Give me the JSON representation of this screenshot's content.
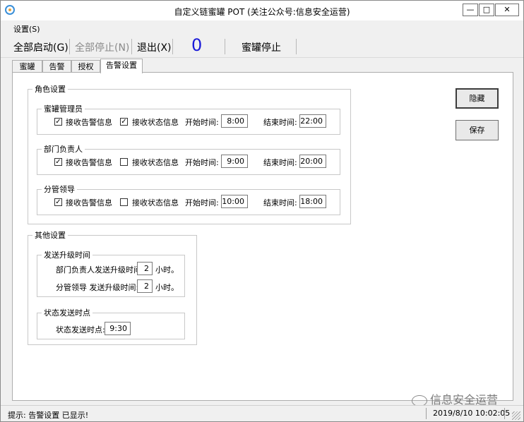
{
  "window": {
    "title": "自定义链蜜罐 POT (关注公众号:信息安全运营)",
    "controls": {
      "minimize": "—",
      "maximize": "□",
      "close": "✕"
    }
  },
  "menu": [
    {
      "label": "设置(S)"
    }
  ],
  "toolbar": {
    "start_all": "全部启动(G)",
    "stop_all": "全部停止(N)",
    "exit": "退出(X)",
    "counter": "0",
    "status": "蜜罐停止"
  },
  "tabs": [
    {
      "label": "蜜罐",
      "active": false
    },
    {
      "label": "告警",
      "active": false
    },
    {
      "label": "授权",
      "active": false
    },
    {
      "label": "告警设置",
      "active": true
    }
  ],
  "role_settings": {
    "legend": "角色设置",
    "roles": [
      {
        "name": "蜜罐管理员",
        "recv_alarm_label": "接收告警信息",
        "recv_alarm": true,
        "recv_status_label": "接收状态信息",
        "recv_status": true,
        "start_label": "开始时间:",
        "start": "8:00",
        "end_label": "结束时间:",
        "end": "22:00"
      },
      {
        "name": "部门负责人",
        "recv_alarm_label": "接收告警信息",
        "recv_alarm": true,
        "recv_status_label": "接收状态信息",
        "recv_status": false,
        "start_label": "开始时间:",
        "start": "9:00",
        "end_label": "结束时间:",
        "end": "20:00"
      },
      {
        "name": "分管领导",
        "recv_alarm_label": "接收告警信息",
        "recv_alarm": true,
        "recv_status_label": "接收状态信息",
        "recv_status": false,
        "start_label": "开始时间:",
        "start": "10:00",
        "end_label": "结束时间:",
        "end": "18:00"
      }
    ]
  },
  "buttons": {
    "hide": "隐藏",
    "save": "保存"
  },
  "other_settings": {
    "legend": "其他设置",
    "escalation": {
      "legend": "发送升级时间",
      "dept_label": "部门负责人发送升级时间:",
      "dept_value": "2",
      "leader_label": "分管领导  发送升级时间:",
      "leader_value": "2",
      "unit": "小时。"
    },
    "status_time": {
      "legend": "状态发送时点",
      "label": "状态发送时点:",
      "value": "9:30"
    }
  },
  "statusbar": {
    "message": "提示: 告警设置 已显示!",
    "datetime": "2019/8/10 10:02:05"
  },
  "watermark": "信息安全运营",
  "checkmark": "✓"
}
